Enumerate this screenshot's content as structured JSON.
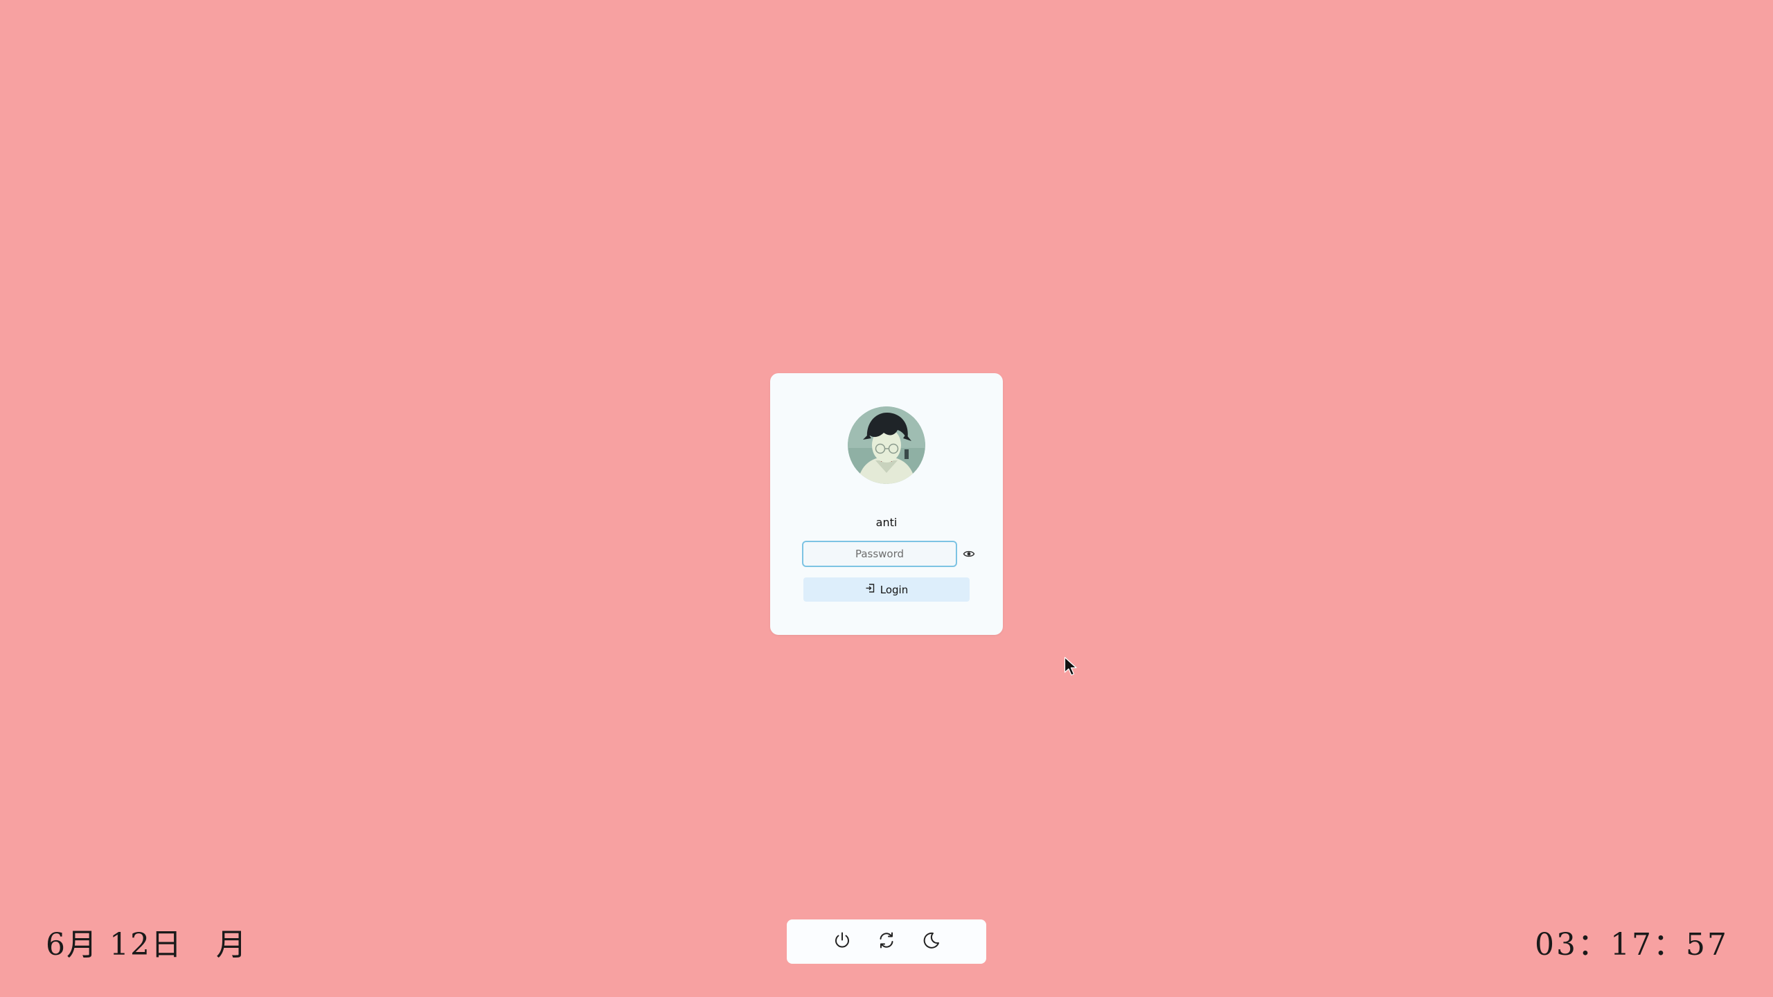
{
  "login": {
    "username": "anti",
    "password_placeholder": "Password",
    "password_value": "",
    "login_label": "Login"
  },
  "status": {
    "date": "6月 12日   月",
    "time": "03：17：57"
  },
  "power_menu": {
    "items": [
      {
        "icon": "power-icon",
        "action": "shutdown"
      },
      {
        "icon": "refresh-icon",
        "action": "restart"
      },
      {
        "icon": "moon-icon",
        "action": "suspend"
      }
    ]
  },
  "colors": {
    "background": "#f7a1a1",
    "card": "#f7fbfd",
    "input_border": "#7cc3e3",
    "button_bg": "#ddeefb"
  }
}
